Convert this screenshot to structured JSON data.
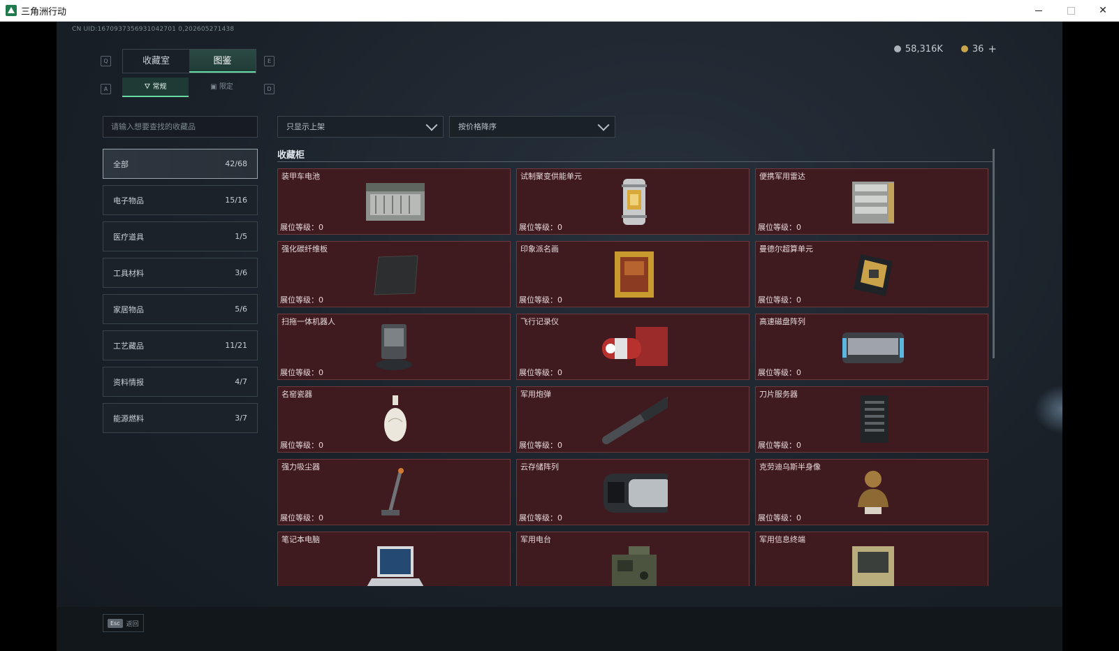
{
  "window": {
    "title": "三角洲行动"
  },
  "uid": "CN UID:1670937356931042701 0,202605271438",
  "currency": {
    "silver": "58,316K",
    "gold": "36",
    "plus": "+"
  },
  "keys": {
    "tab_left": "Q",
    "tab_right": "E",
    "sub_left": "A",
    "sub_right": "D"
  },
  "tabs": [
    {
      "label": "收藏室"
    },
    {
      "label": "图鉴"
    }
  ],
  "subtabs": [
    {
      "label": "常规"
    },
    {
      "label": "限定"
    }
  ],
  "search": {
    "placeholder": "请输入想要查找的收藏品"
  },
  "categories": [
    {
      "label": "全部",
      "count": "42/68"
    },
    {
      "label": "电子物品",
      "count": "15/16"
    },
    {
      "label": "医疗道具",
      "count": "1/5"
    },
    {
      "label": "工具材料",
      "count": "3/6"
    },
    {
      "label": "家居物品",
      "count": "5/6"
    },
    {
      "label": "工艺藏品",
      "count": "11/21"
    },
    {
      "label": "资料情报",
      "count": "4/7"
    },
    {
      "label": "能源燃料",
      "count": "3/7"
    }
  ],
  "filters": {
    "shelf": "只显示上架",
    "sort": "按价格降序"
  },
  "section_title": "收藏柜",
  "items": [
    {
      "name": "装甲车电池",
      "level": "展位等级：0"
    },
    {
      "name": "试制聚变供能单元",
      "level": "展位等级：0"
    },
    {
      "name": "便携军用雷达",
      "level": "展位等级：0"
    },
    {
      "name": "强化碳纤维板",
      "level": "展位等级：0"
    },
    {
      "name": "印象派名画",
      "level": "展位等级：0"
    },
    {
      "name": "曼德尔超算单元",
      "level": "展位等级：0"
    },
    {
      "name": "扫拖一体机器人",
      "level": "展位等级：0"
    },
    {
      "name": "飞行记录仪",
      "level": "展位等级：0"
    },
    {
      "name": "高速磁盘阵列",
      "level": "展位等级：0"
    },
    {
      "name": "名窑瓷器",
      "level": "展位等级：0"
    },
    {
      "name": "军用炮弹",
      "level": "展位等级：0"
    },
    {
      "name": "刀片服务器",
      "level": "展位等级：0"
    },
    {
      "name": "强力吸尘器",
      "level": "展位等级：0"
    },
    {
      "name": "云存储阵列",
      "level": "展位等级：0"
    },
    {
      "name": "克劳迪乌斯半身像",
      "level": "展位等级：0"
    },
    {
      "name": "笔记本电脑",
      "level": ""
    },
    {
      "name": "军用电台",
      "level": ""
    },
    {
      "name": "军用信息终端",
      "level": ""
    }
  ],
  "footer": {
    "esc_key": "Esc",
    "back": "返回"
  }
}
